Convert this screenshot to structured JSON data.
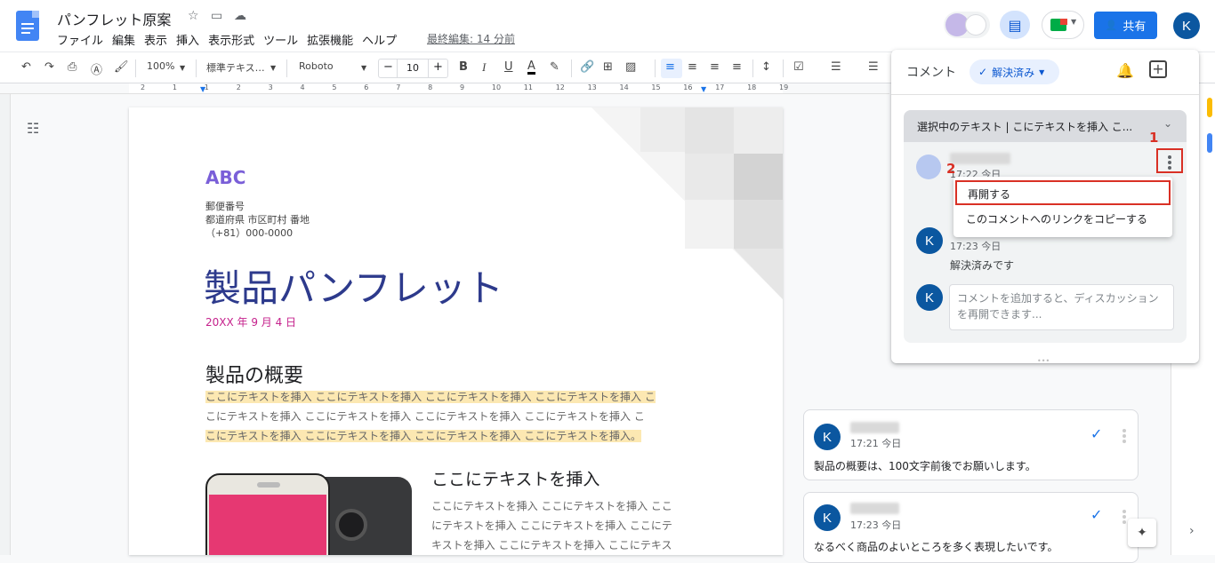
{
  "doc": {
    "title": "パンフレット原案",
    "menus": [
      "ファイル",
      "編集",
      "表示",
      "挿入",
      "表示形式",
      "ツール",
      "拡張機能",
      "ヘルプ"
    ],
    "last_edit": "最終編集: 14 分前",
    "share_label": "共有",
    "user_initial": "K"
  },
  "toolbar": {
    "zoom": "100%",
    "style": "標準テキス…",
    "font": "Roboto",
    "font_size": "10",
    "bold": "B",
    "italic": "I",
    "underline": "U",
    "text_color": "A"
  },
  "ruler": {
    "ticks": [
      "2",
      "1",
      "1",
      "2",
      "3",
      "4",
      "5",
      "6",
      "7",
      "8",
      "9",
      "10",
      "11",
      "12",
      "13",
      "14",
      "15",
      "16",
      "17",
      "18",
      "19"
    ]
  },
  "page": {
    "brand": "ABC",
    "address": [
      "郵便番号",
      "都道府県 市区町村 番地",
      "（+81）000-0000"
    ],
    "title": "製品パンフレット",
    "date": "20XX 年 9 月 4 日",
    "heading": "製品の概要",
    "body_lines": [
      "ここにテキストを挿入 ここにテキストを挿入 ここにテキストを挿入 ここにテキストを挿入 こ",
      "こにテキストを挿入 ここにテキストを挿入 ここにテキストを挿入 ここにテキストを挿入 こ",
      "こにテキストを挿入 ここにテキストを挿入 ここにテキストを挿入 ここにテキストを挿入。"
    ],
    "sub_heading": "ここにテキストを挿入",
    "sub_lines": [
      "ここにテキストを挿入 ここにテキストを挿入 ここ",
      "にテキストを挿入 ここにテキストを挿入 ここにテ",
      "キストを挿入 ここにテキストを挿入 ここにテキス"
    ]
  },
  "comments_panel": {
    "title": "コメント",
    "filter": "解決済み",
    "thread_header": "選択中のテキスト | こにテキストを挿入 こ...",
    "first_time": "17:22 今日",
    "reply_initial": "K",
    "reply_time": "17:23 今日",
    "reply_text": "解決済みです",
    "input_placeholder": "コメントを追加すると、ディスカッションを再開できます...",
    "menu_items": [
      "再開する",
      "このコメントへのリンクをコピーする"
    ],
    "annotation_1": "1",
    "annotation_2": "2"
  },
  "side_comments": [
    {
      "initial": "K",
      "time": "17:21 今日",
      "text": "製品の概要は、100文字前後でお願いします。"
    },
    {
      "initial": "K",
      "time": "17:23 今日",
      "text": "なるべく商品のよいところを多く表現したいです。"
    }
  ],
  "colors": {
    "accent": "#1a73e8",
    "brand_purple": "#7a5fd8",
    "title_blue": "#2d3a8c",
    "date_pink": "#c5218c",
    "highlight": "#fce8b2",
    "annotation_red": "#d93025"
  }
}
